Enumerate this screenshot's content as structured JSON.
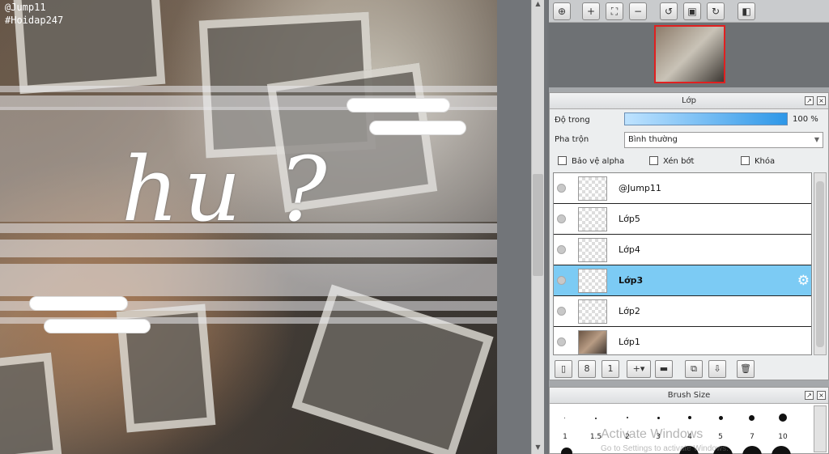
{
  "canvas": {
    "watermark_line1": "@Jump11",
    "watermark_line2": "#Hoidap247",
    "handwriting": "hu ?"
  },
  "toolbar": {
    "buttons": [
      "zoom-fit-icon",
      "zoom-in-icon",
      "fit-screen-icon",
      "zoom-out-icon",
      "rotate-left-icon",
      "reset-view-icon",
      "rotate-right-icon",
      "flip-icon"
    ]
  },
  "layer_panel": {
    "title": "Lớp",
    "opacity_label": "Độ trong",
    "opacity_value": "100 %",
    "opacity_fraction": 1.0,
    "blend_label": "Pha trộn",
    "blend_value": "Bình thường",
    "checkboxes": [
      {
        "label": "Bảo vệ alpha",
        "checked": false
      },
      {
        "label": "Xén bớt",
        "checked": false
      },
      {
        "label": "Khóa",
        "checked": false
      }
    ],
    "layers": [
      {
        "name": "@Jump11",
        "selected": false
      },
      {
        "name": "Lớp5",
        "selected": false
      },
      {
        "name": "Lớp4",
        "selected": false
      },
      {
        "name": "Lớp3",
        "selected": true
      },
      {
        "name": "Lớp2",
        "selected": false
      },
      {
        "name": "Lớp1",
        "selected": false
      }
    ]
  },
  "brush_panel": {
    "title": "Brush Size",
    "sizes": [
      "1",
      "1.5",
      "2",
      "3",
      "4",
      "5",
      "7",
      "10"
    ]
  },
  "os_watermark": {
    "line1": "Activate Windows",
    "line2": "Go to Settings to activate Windows."
  },
  "colors": {
    "selected_layer": "#7ccbf4",
    "opacity_bar": "#2d97e8",
    "navigator_frame": "#e02020"
  }
}
